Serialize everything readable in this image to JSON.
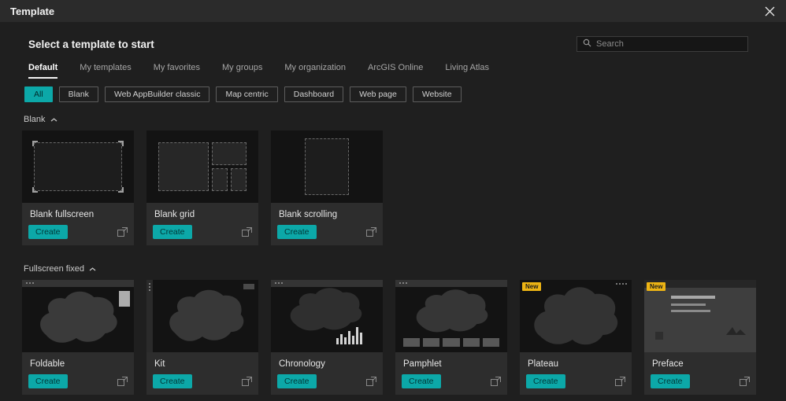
{
  "header": {
    "title": "Template"
  },
  "main": {
    "heading": "Select a template to start",
    "search_placeholder": "Search"
  },
  "tabs": [
    {
      "label": "Default",
      "active": true
    },
    {
      "label": "My templates"
    },
    {
      "label": "My favorites"
    },
    {
      "label": "My groups"
    },
    {
      "label": "My organization"
    },
    {
      "label": "ArcGIS Online"
    },
    {
      "label": "Living Atlas"
    }
  ],
  "filters": [
    {
      "label": "All",
      "active": true
    },
    {
      "label": "Blank"
    },
    {
      "label": "Web AppBuilder classic"
    },
    {
      "label": "Map centric"
    },
    {
      "label": "Dashboard"
    },
    {
      "label": "Web page"
    },
    {
      "label": "Website"
    }
  ],
  "labels": {
    "create": "Create",
    "new_badge": "New"
  },
  "sections": [
    {
      "title": "Blank",
      "cards": [
        {
          "title": "Blank fullscreen"
        },
        {
          "title": "Blank grid"
        },
        {
          "title": "Blank scrolling"
        }
      ]
    },
    {
      "title": "Fullscreen fixed",
      "cards": [
        {
          "title": "Foldable"
        },
        {
          "title": "Kit"
        },
        {
          "title": "Chronology"
        },
        {
          "title": "Pamphlet"
        },
        {
          "title": "Plateau",
          "badge": "New"
        },
        {
          "title": "Preface",
          "badge": "New"
        }
      ]
    }
  ],
  "colors": {
    "accent": "#0ca8a8",
    "badge": "#edb414",
    "background": "#1f1f1f"
  }
}
